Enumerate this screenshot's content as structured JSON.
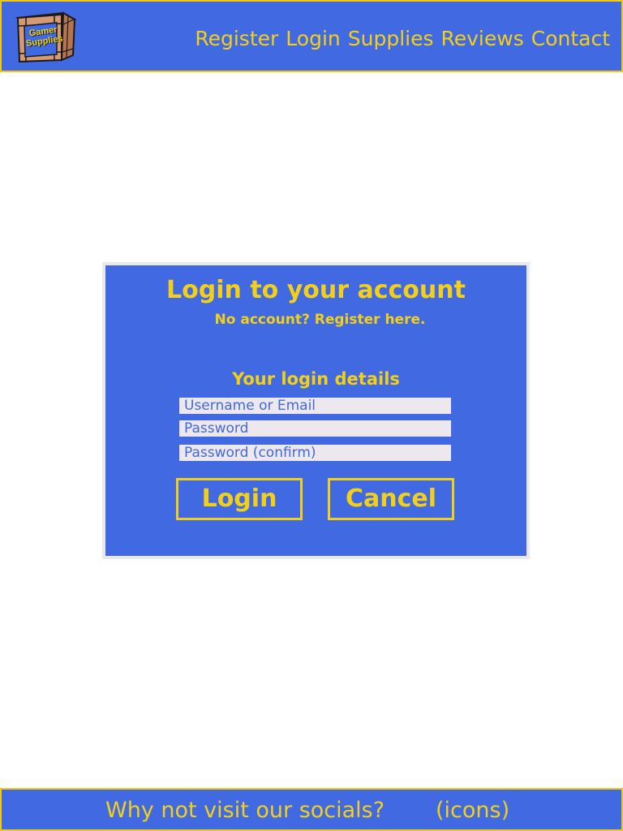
{
  "header": {
    "logo_text": "Gamer Supplies",
    "nav": [
      {
        "label": "Register"
      },
      {
        "label": "Login"
      },
      {
        "label": "Supplies"
      },
      {
        "label": "Reviews"
      },
      {
        "label": "Contact"
      }
    ]
  },
  "login": {
    "title": "Login to your account",
    "register_prompt": "No account? Register here.",
    "details_heading": "Your login details",
    "username_placeholder": "Username or Email",
    "password_placeholder": "Password",
    "confirm_placeholder": "Password (confirm)",
    "login_label": "Login",
    "cancel_label": "Cancel"
  },
  "footer": {
    "socials_text": "Why not visit our socials?",
    "icons_text": "(icons)"
  },
  "colors": {
    "brand_blue": "#4169e1",
    "accent_yellow": "#f2d019",
    "field_background": "#ece8ee",
    "panel_border": "#ece8f0"
  },
  "icons": {
    "logo": "wooden-crate-logo"
  }
}
